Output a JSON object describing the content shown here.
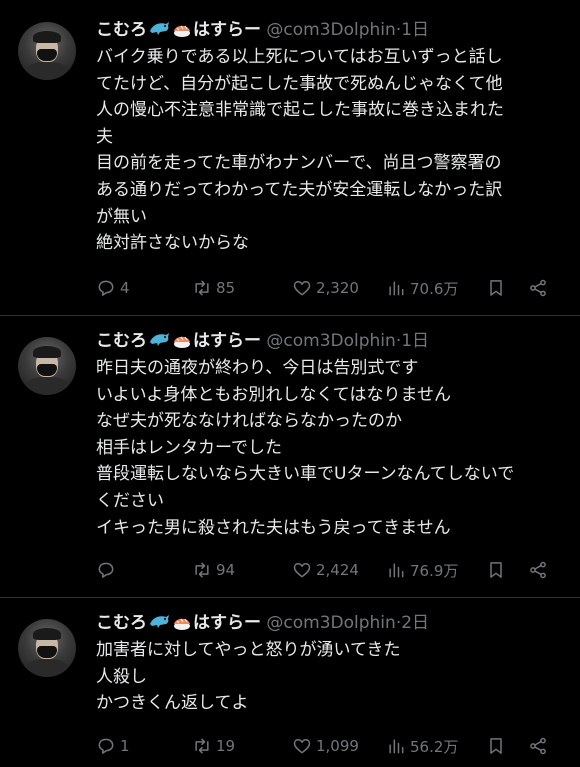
{
  "tweets": [
    {
      "name": "こむろ",
      "name_suffix": "はすらー",
      "handle": "@com3Dolphin",
      "time": "1日",
      "lines": [
        "バイク乗りである以上死についてはお互いずっと話し",
        "てたけど、自分が起こした事故で死ぬんじゃなくて他",
        "人の慢心不注意非常識で起こした事故に巻き込まれた",
        "夫",
        "目の前を走ってた車がわナンバーで、尚且つ警察署の",
        "ある通りだってわかってた夫が安全運転しなかった訳",
        "が無い",
        "絶対許さないからな"
      ],
      "replies": "4",
      "retweets": "85",
      "likes": "2,320",
      "views": "70.6万"
    },
    {
      "name": "こむろ",
      "name_suffix": "はすらー",
      "handle": "@com3Dolphin",
      "time": "1日",
      "lines": [
        "昨日夫の通夜が終わり、今日は告別式です",
        "いよいよ身体ともお別れしなくてはなりません",
        "なぜ夫が死ななければならなかったのか",
        "相手はレンタカーでした",
        "普段運転しないなら大きい車でUターンなんてしないで",
        "ください",
        "イキった男に殺された夫はもう戻ってきません"
      ],
      "replies": "",
      "retweets": "94",
      "likes": "2,424",
      "views": "76.9万"
    },
    {
      "name": "こむろ",
      "name_suffix": "はすらー",
      "handle": "@com3Dolphin",
      "time": "2日",
      "lines": [
        "加害者に対してやっと怒りが湧いてきた",
        "人殺し",
        "かつきくん返してよ"
      ],
      "replies": "1",
      "retweets": "19",
      "likes": "1,099",
      "views": "56.2万"
    }
  ],
  "icons": [
    "dolphin-emoji",
    "sushi-emoji",
    "reply-icon",
    "retweet-icon",
    "heart-icon",
    "views-icon",
    "bookmark-icon",
    "share-icon"
  ],
  "colors": {
    "background": "#000000",
    "text": "#e7e9ea",
    "muted": "#71767b",
    "divider": "#2f3336"
  }
}
